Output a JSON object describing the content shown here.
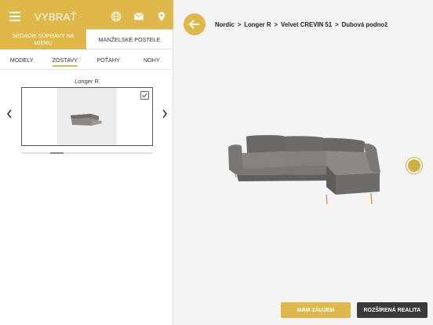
{
  "header": {
    "title": "VYBRAŤ",
    "icons": [
      "menu-icon",
      "globe-icon",
      "mail-icon",
      "location-pin-icon"
    ]
  },
  "segments": [
    {
      "label": "SEDACIE SÚPRAVY NA MIERU",
      "active": true
    },
    {
      "label": "MANŽELSKÉ POSTELE",
      "active": false
    }
  ],
  "tabs": [
    {
      "label": "MODELY"
    },
    {
      "label": "ZOSTAVY",
      "selected": true
    },
    {
      "label": "POŤAHY"
    },
    {
      "label": "NOHY"
    }
  ],
  "carousel": {
    "label": "Longer R",
    "checked": true
  },
  "breadcrumb": [
    "Nordic",
    "Longer R",
    "Velvet CREVIN 51",
    "Dubová podnož"
  ],
  "breadcrumb_separator": ">",
  "actions": {
    "interest_label": "MÁM ZÁUJEM",
    "ar_label": "ROZŠÍRENÁ REALITA"
  },
  "colors": {
    "accent": "#e0b84a",
    "dark_button": "#3a3a3a",
    "sofa_fabric": "#7a7876",
    "wood_legs": "#c89870"
  }
}
